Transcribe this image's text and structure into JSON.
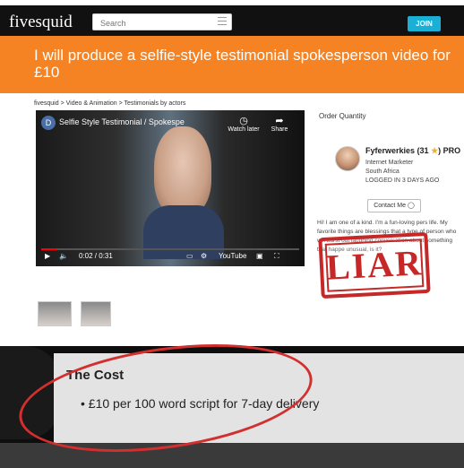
{
  "header": {
    "logo": "fivesquid",
    "search_placeholder": "Search",
    "join_label": "JOIN"
  },
  "gig": {
    "title": "I will produce a selfie-style testimonial spokesperson video for £10",
    "breadcrumb": "fivesquid > Video & Animation > Testimonials by actors"
  },
  "video": {
    "channel_initial": "D",
    "title": "Selfie Style Testimonial / Spokespe",
    "watch_later": "Watch later",
    "share": "Share",
    "time": "0:02 / 0:31",
    "youtube": "YouTube",
    "progress_fraction": 0.06
  },
  "sidebar": {
    "order_quantity": "Order Quantity",
    "seller": {
      "name": "Fyferwerkies (31",
      "pro": "PRO",
      "role": "Internet Marketer",
      "location": "South Africa",
      "logged_in": "LOGGED IN 3 DAYS AGO",
      "contact_label": "Contact Me"
    },
    "bio": "Hi! I am one of a kind. I'm a fun-loving pers life. My favorite things are blessings that a type of person who will burst out laughing conversation about something that happe unusual, is it?"
  },
  "stamp": {
    "text": "LIAR",
    "color": "#c62828"
  },
  "cost": {
    "title": "The Cost",
    "item": "£10 per 100 word script for 7-day delivery"
  },
  "colors": {
    "banner": "#f58323",
    "navbar": "#111111",
    "join": "#1ab0d6",
    "highlight": "#d32f2f"
  }
}
